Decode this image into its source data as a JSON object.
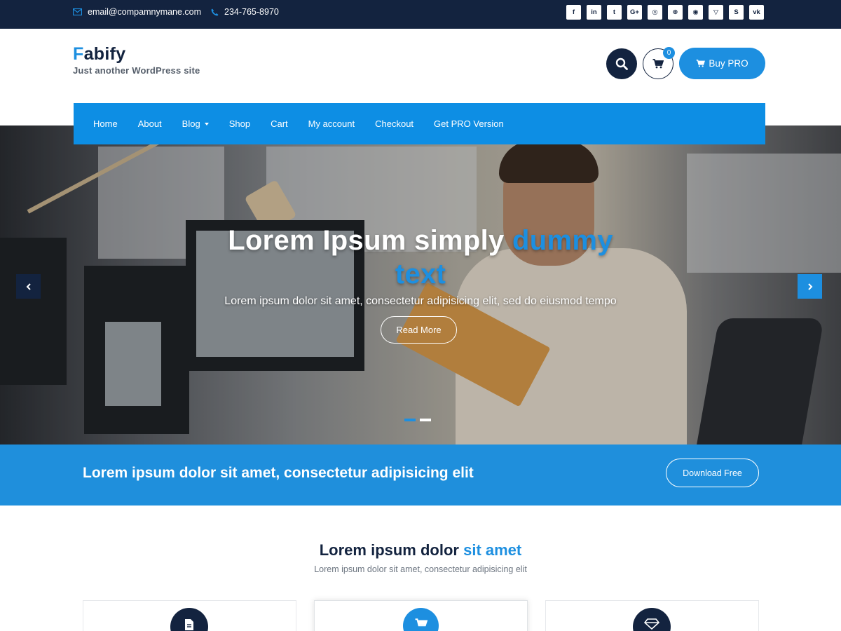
{
  "topbar": {
    "email": "email@compamnymane.com",
    "phone": "234-765-8970",
    "socials": [
      {
        "icon": "facebook-icon",
        "glyph": "f"
      },
      {
        "icon": "linkedin-icon",
        "glyph": "in"
      },
      {
        "icon": "twitter-icon",
        "glyph": "t"
      },
      {
        "icon": "google-plus-icon",
        "glyph": "G+"
      },
      {
        "icon": "instagram-icon",
        "glyph": "◎"
      },
      {
        "icon": "dribbble-icon",
        "glyph": "⊛"
      },
      {
        "icon": "github-icon",
        "glyph": "◉"
      },
      {
        "icon": "foursquare-icon",
        "glyph": "▽"
      },
      {
        "icon": "skype-icon",
        "glyph": "S"
      },
      {
        "icon": "vk-icon",
        "glyph": "vk"
      }
    ]
  },
  "header": {
    "brand_initial": "F",
    "brand_rest": "abify",
    "tagline": "Just another WordPress site",
    "cart_count": "0",
    "buy_label": "Buy PRO"
  },
  "menu": {
    "items": [
      "Home",
      "About",
      "Blog",
      "Shop",
      "Cart",
      "My account",
      "Checkout",
      "Get PRO Version"
    ]
  },
  "hero": {
    "title_plain": "Lorem Ipsum simply ",
    "title_highlight_1": "dummy",
    "title_highlight_2": "text",
    "subtitle": "Lorem ipsum dolor sit amet, consectetur adipisicing elit, sed do eiusmod tempo",
    "button": "Read More"
  },
  "cta": {
    "text": "Lorem ipsum dolor sit amet, consectetur adipisicing elit",
    "button": "Download Free"
  },
  "section": {
    "title_plain": "Lorem ipsum dolor ",
    "title_highlight": "sit amet",
    "subtitle": "Lorem ipsum dolor sit amet, consectetur adipisicing elit"
  },
  "colors": {
    "navy": "#13233f",
    "accent": "#1d8fe0"
  }
}
